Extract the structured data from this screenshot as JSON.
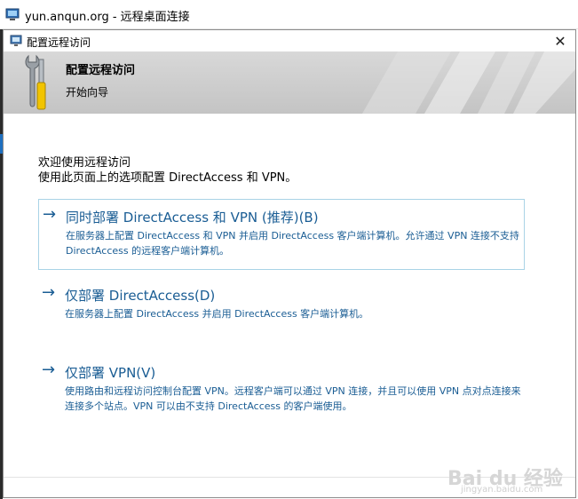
{
  "window": {
    "title": "yun.anqun.org - 远程桌面连接"
  },
  "dialog": {
    "title": "配置远程访问",
    "close_glyph": "✕"
  },
  "banner": {
    "heading": "配置远程访问",
    "subheading": "开始向导"
  },
  "intro": {
    "line1": "欢迎使用远程访问",
    "line2": "使用此页面上的选项配置 DirectAccess 和 VPN。"
  },
  "options": [
    {
      "arrow": "→",
      "title": "同时部署 DirectAccess 和 VPN (推荐)(B)",
      "description": "在服务器上配置 DirectAccess 和 VPN 并启用 DirectAccess 客户端计算机。允许通过 VPN 连接不支持 DirectAccess 的远程客户端计算机。",
      "selected": true
    },
    {
      "arrow": "→",
      "title": "仅部署 DirectAccess(D)",
      "description": "在服务器上配置 DirectAccess 并启用 DirectAccess 客户端计算机。",
      "selected": false
    },
    {
      "arrow": "→",
      "title": "仅部署 VPN(V)",
      "description": "使用路由和远程访问控制台配置 VPN。远程客户端可以通过 VPN 连接，并且可以使用 VPN 点对点连接来连接多个站点。VPN 可以由不支持 DirectAccess 的客户端使用。",
      "selected": false
    }
  ],
  "watermark": {
    "brand": "Bai du 经验",
    "url": "jingyan.baidu.com"
  },
  "colors": {
    "link_blue": "#1a5d94",
    "selected_border": "#a9d3e6",
    "banner_gray": "#c8c8c8"
  },
  "icons": {
    "window": "remote-desktop-icon",
    "dialog": "remote-access-icon",
    "banner": "wrench-screwdriver-icon"
  }
}
